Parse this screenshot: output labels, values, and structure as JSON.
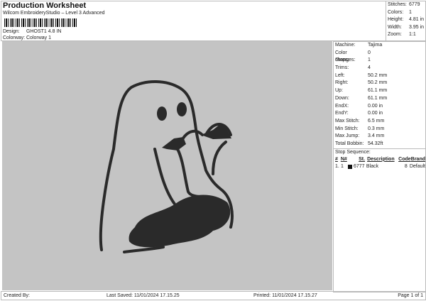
{
  "header": {
    "title": "Production Worksheet",
    "subtitle": "Wilcom EmbroideryStudio – Level 3 Advanced",
    "design_label": "Design:",
    "design_value": "GHOST1 4.8 IN",
    "colorway_label": "Colorway:",
    "colorway_value": "Colorway 1"
  },
  "stats": [
    {
      "label": "Stitches:",
      "value": "6779"
    },
    {
      "label": "Colors:",
      "value": "1"
    },
    {
      "label": "Height:",
      "value": "4.81 in"
    },
    {
      "label": "Width:",
      "value": "3.95 in"
    },
    {
      "label": "Zoom:",
      "value": "1:1"
    }
  ],
  "props": [
    {
      "label": "Machine:",
      "value": "Tajima"
    },
    {
      "label": "Color changes:",
      "value": "0"
    },
    {
      "label": "Stops:",
      "value": "1"
    },
    {
      "label": "Trims:",
      "value": "4"
    },
    {
      "label": "Left:",
      "value": "50.2 mm"
    },
    {
      "label": "Right:",
      "value": "50.2 mm"
    },
    {
      "label": "Up:",
      "value": "61.1 mm"
    },
    {
      "label": "Down:",
      "value": "61.1 mm"
    },
    {
      "label": "EndX:",
      "value": "0.00 in"
    },
    {
      "label": "EndY:",
      "value": "0.00 in"
    },
    {
      "label": "Max Stitch:",
      "value": "6.5 mm"
    },
    {
      "label": "Min Stitch:",
      "value": "0.3 mm"
    },
    {
      "label": "Max Jump:",
      "value": "3.4 mm"
    },
    {
      "label": "Total Bobbin:",
      "value": "54.32ft"
    }
  ],
  "stop_sequence": {
    "title": "Stop Sequence:",
    "headers": [
      "#",
      "N#",
      "St.",
      "Description",
      "Code",
      "Brand"
    ],
    "rows": [
      {
        "num": "1.",
        "n": "1",
        "color": "#111111",
        "st": "6777",
        "description": "Black",
        "code": "8",
        "brand": "Default"
      }
    ]
  },
  "footer": {
    "created_by": "Created By:",
    "last_saved": "Last Saved: 11/01/2024 17.15.25",
    "printed": "Printed: 11/01/2024 17.15.27",
    "page": "Page 1 of 1"
  }
}
